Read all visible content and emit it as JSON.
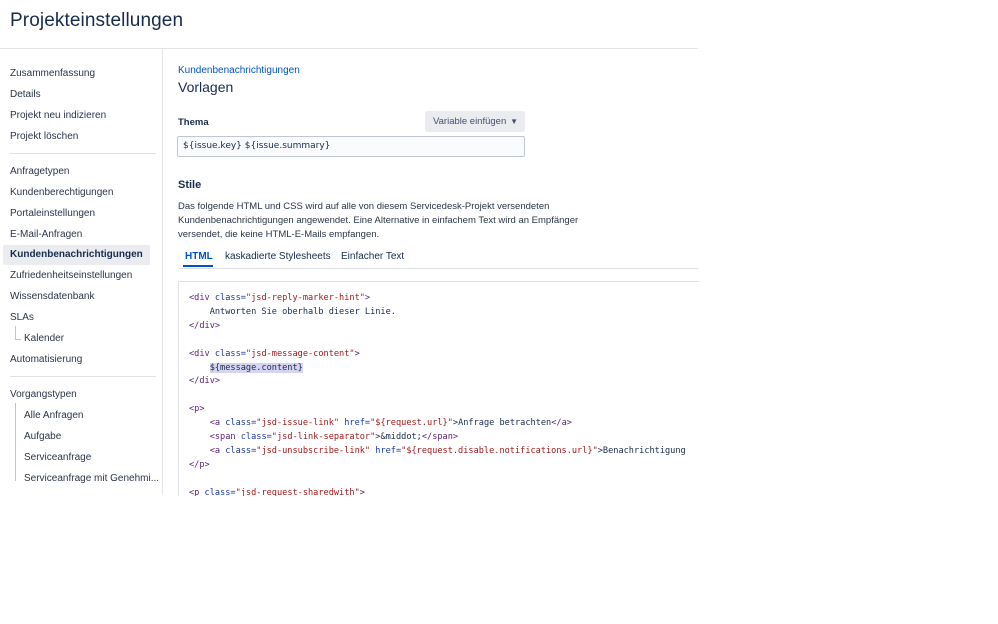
{
  "page_title": "Projekteinstellungen",
  "sidebar": {
    "group1": [
      "Zusammenfassung",
      "Details",
      "Projekt neu indizieren",
      "Projekt löschen"
    ],
    "group2": [
      "Anfragetypen",
      "Kundenberechtigungen",
      "Portaleinstellungen",
      "E-Mail-Anfragen",
      "Kundenbenachrichtigungen",
      "Zufriedenheitseinstellungen",
      "Wissensdatenbank",
      "SLAs"
    ],
    "slas_child": "Kalender",
    "automation": "Automatisierung",
    "group3_title": "Vorgangstypen",
    "group3_children": [
      "Alle Anfragen",
      "Aufgabe",
      "Serviceanfrage",
      "Serviceanfrage mit Genehmi..."
    ]
  },
  "main": {
    "breadcrumb": "Kundenbenachrichtigungen",
    "title": "Vorlagen",
    "subject_label": "Thema",
    "insert_variable_button": "Variable einfügen",
    "subject_value": "${issue.key} ${issue.summary}",
    "styles_title": "Stile",
    "description": "Das folgende HTML und CSS wird auf alle von diesem Servicedesk-Projekt versendeten Kundenbenachrichtigungen angewendet. Eine Alternative in einfachem Text wird an Empfänger versendet, die keine HTML-E-Mails empfangen.",
    "tabs": [
      "HTML",
      "kaskadierte Stylesheets",
      "Einfacher Text"
    ],
    "active_tab": "HTML"
  },
  "code": {
    "l1_open": "<div ",
    "l1_attr": "class=",
    "l1_val": "\"jsd-reply-marker-hint\"",
    "l1_close": ">",
    "l2_text": "    Antworten Sie oberhalb dieser Linie.",
    "l3": "</div>",
    "l5_open": "<div ",
    "l5_attr": "class=",
    "l5_val": "\"jsd-message-content\"",
    "l5_close": ">",
    "l6_indent": "    ",
    "l6_var": "${message.content}",
    "l7": "</div>",
    "l9": "<p>",
    "l10_open": "    <a ",
    "l10_attr1": "class=",
    "l10_val1": "\"jsd-issue-link\"",
    "l10_attr2": " href=",
    "l10_val2": "\"${request.url}\"",
    "l10_text": ">Anfrage betrachten",
    "l10_close": "</a>",
    "l11_open": "    <span ",
    "l11_attr": "class=",
    "l11_val": "\"jsd-link-separator\"",
    "l11_text": ">&middot;",
    "l11_close": "</span>",
    "l12_open": "    <a ",
    "l12_attr1": "class=",
    "l12_val1": "\"jsd-unsubscribe-link\"",
    "l12_attr2": " href=",
    "l12_val2": "\"${request.disable.notifications.url}\"",
    "l12_text": ">Benachrichtigung",
    "l13": "</p>",
    "l15_open": "<p ",
    "l15_attr": "class=",
    "l15_val": "\"jsd-request-sharedwith\"",
    "l15_close": ">"
  },
  "colors": {
    "link": "#0052cc",
    "text": "#172b4d",
    "selected_bg": "#ebecf0",
    "code_tag": "#5a1f7a",
    "code_attr_name": "#1a3a9e",
    "code_attr_value": "#a11a1a",
    "highlight": "#d7d4ef"
  },
  "icons": {
    "dropdown": "chevron-down-icon"
  }
}
